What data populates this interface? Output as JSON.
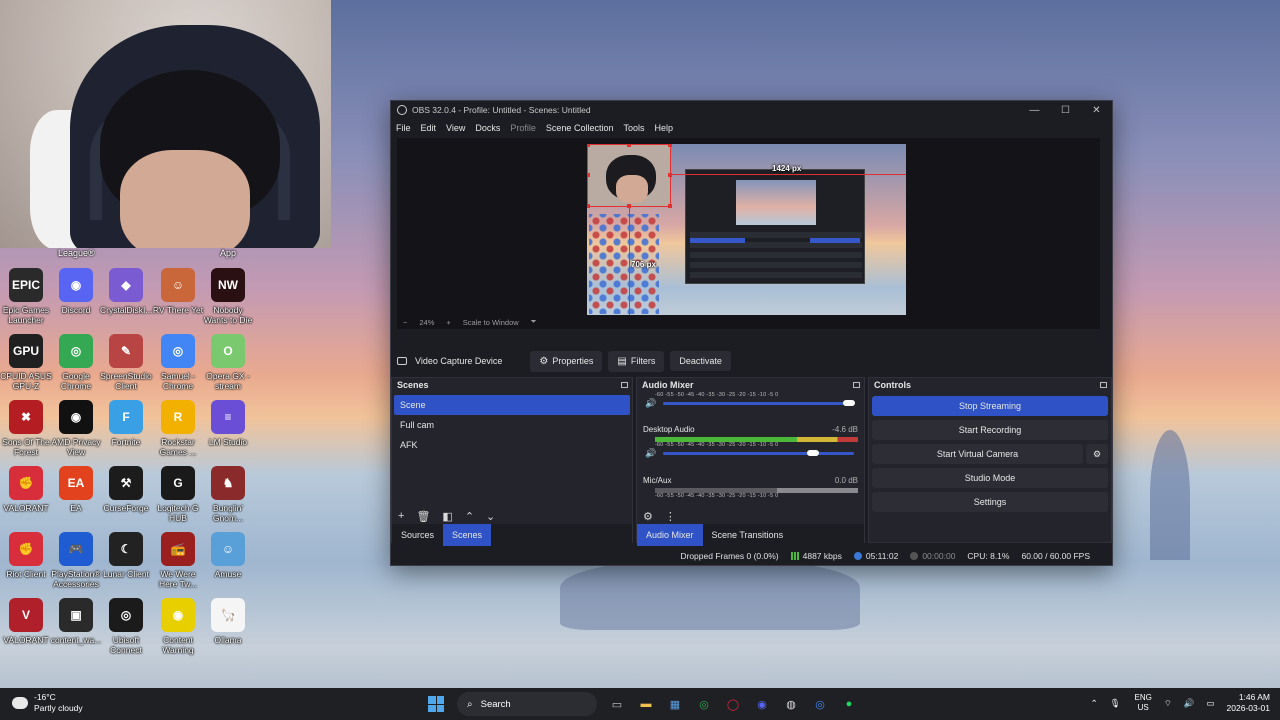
{
  "webcam": {
    "top_labels": [
      "League®",
      "App"
    ]
  },
  "desktop_icons": [
    {
      "label": "Epic Games Launcher",
      "glyph": "EPIC",
      "color": "#2a2a2a"
    },
    {
      "label": "Discord",
      "glyph": "◉",
      "color": "#5865f2"
    },
    {
      "label": "CrystalDiskI...",
      "glyph": "◆",
      "color": "#7a5bd1"
    },
    {
      "label": "RV There Yet",
      "glyph": "☺",
      "color": "#c9673a"
    },
    {
      "label": "Nobody Wants to Die",
      "glyph": "NW",
      "color": "#2a1012"
    },
    {
      "label": "CPUID ASUS GPU-Z",
      "glyph": "GPU",
      "color": "#202020"
    },
    {
      "label": "Google Chrome",
      "glyph": "◎",
      "color": "#34a853"
    },
    {
      "label": "SpreenStudio Client",
      "glyph": "✎",
      "color": "#b84444"
    },
    {
      "label": "Samuel - Chrome",
      "glyph": "◎",
      "color": "#4285f4"
    },
    {
      "label": "Opera GX - stream",
      "glyph": "O",
      "color": "#7bc96f"
    },
    {
      "label": "Sons Of The Forest",
      "glyph": "✖",
      "color": "#b41e22"
    },
    {
      "label": "AMD Privacy View",
      "glyph": "◉",
      "color": "#111111"
    },
    {
      "label": "Fortnite",
      "glyph": "F",
      "color": "#3aa0e6"
    },
    {
      "label": "Rockstar Games ...",
      "glyph": "R",
      "color": "#f2b100"
    },
    {
      "label": "LM Studio",
      "glyph": "≡",
      "color": "#6a4fd6"
    },
    {
      "label": "VALORANT",
      "glyph": "✊",
      "color": "#d82d3a"
    },
    {
      "label": "EA",
      "glyph": "EA",
      "color": "#e2431e"
    },
    {
      "label": "CurseForge",
      "glyph": "⚒",
      "color": "#1c1c1c"
    },
    {
      "label": "Logitech G HUB",
      "glyph": "G",
      "color": "#1a1a1a"
    },
    {
      "label": "Bunglin' Gnom...",
      "glyph": "♞",
      "color": "#8a2a2a"
    },
    {
      "label": "Riot Client",
      "glyph": "✊",
      "color": "#d82d3a"
    },
    {
      "label": "PlayStation® Accessories",
      "glyph": "🎮",
      "color": "#1f5bd1"
    },
    {
      "label": "Lunar Client",
      "glyph": "☾",
      "color": "#222222"
    },
    {
      "label": "We Were Here Tw...",
      "glyph": "📻",
      "color": "#9a2020"
    },
    {
      "label": "Amuse",
      "glyph": "☺",
      "color": "#5aa0d8"
    },
    {
      "label": "VALORANT",
      "glyph": "V",
      "color": "#b0202a"
    },
    {
      "label": "content_wa...",
      "glyph": "▣",
      "color": "#2a2a2a"
    },
    {
      "label": "Ubisoft Connect",
      "glyph": "◎",
      "color": "#1b1b1b"
    },
    {
      "label": "Content Warning",
      "glyph": "◉",
      "color": "#e8d000"
    },
    {
      "label": "Ollama",
      "glyph": "🦙",
      "color": "#f5f5f5"
    }
  ],
  "obs": {
    "title": "OBS 32.0.4 - Profile: Untitled - Scenes: Untitled",
    "window_controls": [
      "—",
      "☐",
      "✕"
    ],
    "menu": [
      {
        "label": "File",
        "enabled": true
      },
      {
        "label": "Edit",
        "enabled": true
      },
      {
        "label": "View",
        "enabled": true
      },
      {
        "label": "Docks",
        "enabled": true
      },
      {
        "label": "Profile",
        "enabled": false
      },
      {
        "label": "Scene Collection",
        "enabled": true
      },
      {
        "label": "Tools",
        "enabled": true
      },
      {
        "label": "Help",
        "enabled": true
      }
    ],
    "preview": {
      "guide_h": "1424 px",
      "guide_v": "706 px",
      "zoom_minus": "−",
      "zoom": "24%",
      "zoom_plus": "+",
      "scale_mode": "Scale to Window",
      "scale_caret": "⏷"
    },
    "source_toolbar": {
      "source_name": "Video Capture Device",
      "properties": "Properties",
      "filters": "Filters",
      "deactivate": "Deactivate"
    },
    "scenes": {
      "title": "Scenes",
      "items": [
        "Scene",
        "Full cam",
        "AFK"
      ],
      "tabs": [
        "Sources",
        "Scenes"
      ]
    },
    "mixer": {
      "title": "Audio Mixer",
      "ticks": "-60  -55  -50  -45  -40  -35  -30  -25  -20  -15  -10   -5    0",
      "channels": [
        {
          "name": "",
          "db": "",
          "volume": 1.0
        },
        {
          "name": "Desktop Audio",
          "db": "-4.6 dB",
          "volume": 0.8
        },
        {
          "name": "Mic/Aux",
          "db": "0.0 dB",
          "volume": 1.0
        }
      ],
      "tabs": [
        "Audio Mixer",
        "Scene Transitions"
      ]
    },
    "controls": {
      "title": "Controls",
      "stop_streaming": "Stop Streaming",
      "start_recording": "Start Recording",
      "start_virtual_camera": "Start Virtual Camera",
      "studio_mode": "Studio Mode",
      "settings": "Settings"
    },
    "status": {
      "dropped_frames": "Dropped Frames 0 (0.0%)",
      "bitrate": "4887 kbps",
      "stream_time": "05:11:02",
      "rec_time": "00:00:00",
      "cpu": "CPU: 8.1%",
      "fps": "60.00 / 60.00 FPS"
    }
  },
  "taskbar": {
    "weather_temp": "-16°C",
    "weather_desc": "Partly cloudy",
    "search_placeholder": "Search",
    "lang_top": "ENG",
    "lang_bottom": "US",
    "time": "1:46 AM",
    "date": "2026-03-01"
  },
  "colors": {
    "accent": "#2f53c6",
    "obs_bg": "#1c1d22",
    "recording_red": "#e23030"
  }
}
